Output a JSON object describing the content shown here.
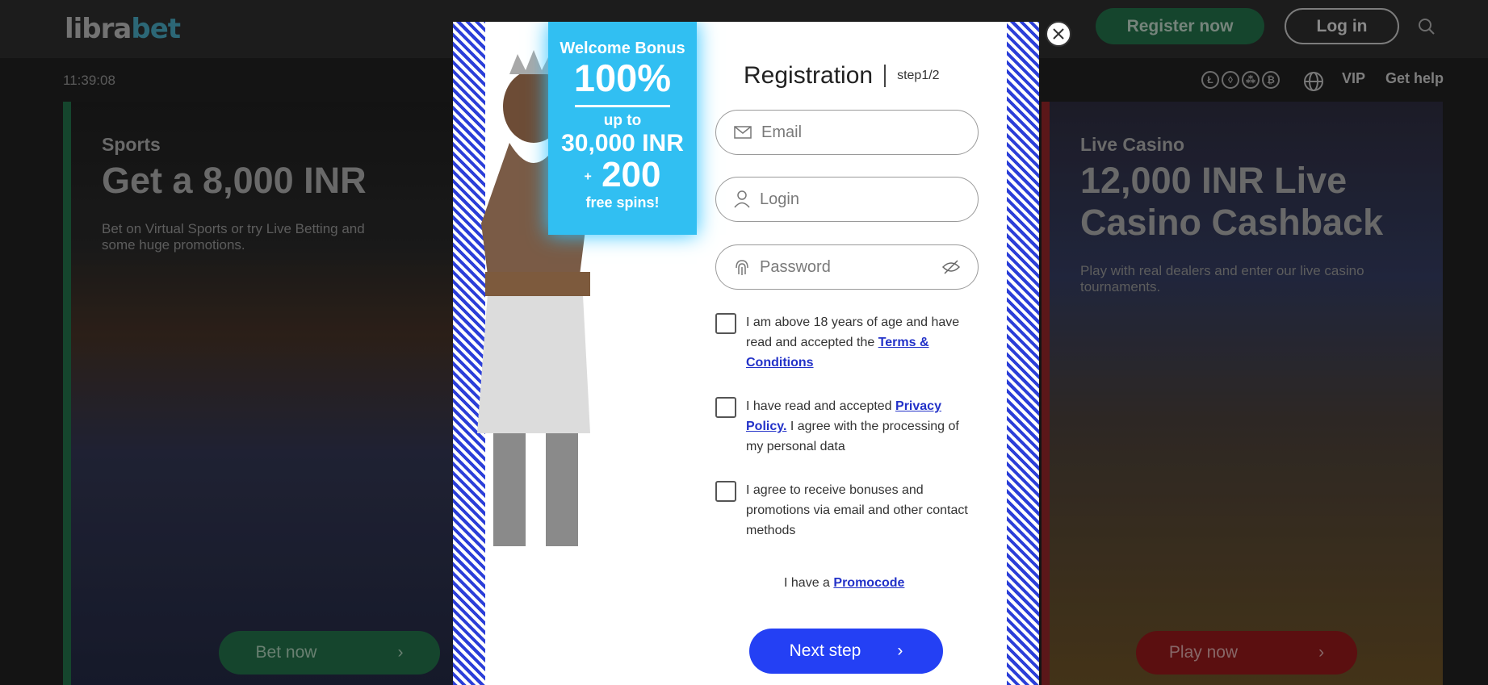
{
  "header": {
    "logo_part1": "libra",
    "logo_part2": "bet",
    "register_label": "Register now",
    "login_label": "Log in"
  },
  "topbar": {
    "time": "11:39:08",
    "crypto_icons": [
      "Ł",
      "◊",
      "⁂",
      "₿"
    ],
    "vip_label": "VIP",
    "help_label": "Get help"
  },
  "cards": {
    "sports": {
      "subtitle": "Sports",
      "headline": "Get a 8,000 INR",
      "description": "Bet on Virtual Sports or try Live Betting and some huge promotions.",
      "button": "Bet now"
    },
    "casino": {
      "subtitle": "Live Casino",
      "headline": "12,000 INR Live Casino Cashback",
      "description": "Play with real dealers and enter our live casino tournaments.",
      "button": "Play now"
    }
  },
  "bonus": {
    "line1": "Welcome Bonus",
    "line2": "100%",
    "line3": "up to",
    "line4": "30,000 INR",
    "plus": "+",
    "line5": "200",
    "line6": "free spins!"
  },
  "registration": {
    "title": "Registration",
    "step": "step1/2",
    "email_placeholder": "Email",
    "login_placeholder": "Login",
    "password_placeholder": "Password",
    "age_text": "I am above 18 years of age and have read and accepted the",
    "age_link": "Terms & Conditions",
    "privacy_text1": "I have read and accepted",
    "privacy_link": "Privacy Policy.",
    "privacy_text2": "I agree with the processing of my personal data",
    "promo_consent_text": "I agree to receive bonuses and promotions via email and other contact methods",
    "promo_text": "I have a",
    "promo_link": "Promocode",
    "next_label": "Next step"
  },
  "colors": {
    "accent_blue": "#2440f4",
    "bonus_blue": "#31bff2",
    "link_blue": "#2332c8",
    "green": "#1d5c3d",
    "red": "#7a1416"
  }
}
